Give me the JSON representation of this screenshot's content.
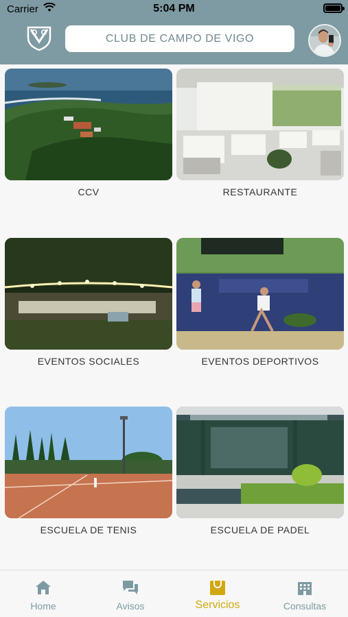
{
  "status_bar": {
    "carrier": "Carrier",
    "time": "5:04 PM"
  },
  "header": {
    "title": "CLUB DE CAMPO DE VIGO"
  },
  "cards": [
    {
      "label": "CCV"
    },
    {
      "label": "RESTAURANTE"
    },
    {
      "label": "EVENTOS SOCIALES"
    },
    {
      "label": "EVENTOS DEPORTIVOS"
    },
    {
      "label": "ESCUELA DE TENIS"
    },
    {
      "label": "ESCUELA DE PADEL"
    }
  ],
  "tabs": [
    {
      "label": "Home",
      "icon": "home-icon"
    },
    {
      "label": "Avisos",
      "icon": "chat-icon"
    },
    {
      "label": "Servicios",
      "icon": "bag-icon",
      "active": true
    },
    {
      "label": "Consultas",
      "icon": "building-icon"
    }
  ],
  "colors": {
    "header": "#7e9aa3",
    "accent": "#d1a80f",
    "tab_inactive": "#7d9aa2",
    "title_text": "#6f8890"
  }
}
